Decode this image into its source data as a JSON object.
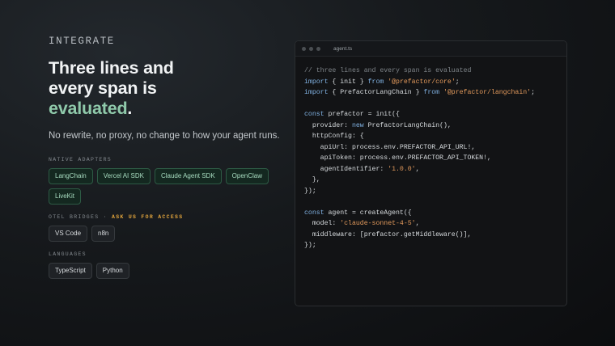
{
  "intro": {
    "eyebrow": "INTEGRATE",
    "headline_line1": "Three lines and",
    "headline_line2": "every span is",
    "headline_accent": "evaluated",
    "headline_period": ".",
    "subline": "No rewrite, no proxy, no change to how your agent runs."
  },
  "groups": {
    "native": {
      "label": "NATIVE ADAPTERS",
      "chips": [
        "LangChain",
        "Vercel AI SDK",
        "Claude Agent SDK",
        "OpenClaw",
        "LiveKit"
      ]
    },
    "otel": {
      "label": "OTEL BRIDGES · ",
      "access": "ASK US FOR ACCESS",
      "chips": [
        "VS Code",
        "n8n"
      ]
    },
    "languages": {
      "label": "LANGUAGES",
      "chips": [
        "TypeScript",
        "Python"
      ]
    }
  },
  "code_panel": {
    "filename": "agent.ts",
    "lines": [
      [
        [
          "com",
          "// three lines and every span is evaluated"
        ]
      ],
      [
        [
          "kw",
          "import"
        ],
        [
          "txt",
          " { init } "
        ],
        [
          "kw",
          "from"
        ],
        [
          "txt",
          " "
        ],
        [
          "str",
          "'@prefactor/core'"
        ],
        [
          "txt",
          ";"
        ]
      ],
      [
        [
          "kw",
          "import"
        ],
        [
          "txt",
          " { PrefactorLangChain } "
        ],
        [
          "kw",
          "from"
        ],
        [
          "txt",
          " "
        ],
        [
          "str",
          "'@prefactor/langchain'"
        ],
        [
          "txt",
          ";"
        ]
      ],
      [],
      [
        [
          "kw",
          "const"
        ],
        [
          "txt",
          " prefactor = init({"
        ]
      ],
      [
        [
          "txt",
          "  provider: "
        ],
        [
          "kw",
          "new"
        ],
        [
          "txt",
          " PrefactorLangChain(),"
        ]
      ],
      [
        [
          "txt",
          "  httpConfig: {"
        ]
      ],
      [
        [
          "txt",
          "    apiUrl: process.env.PREFACTOR_API_URL!,"
        ]
      ],
      [
        [
          "txt",
          "    apiToken: process.env.PREFACTOR_API_TOKEN!,"
        ]
      ],
      [
        [
          "txt",
          "    agentIdentifier: "
        ],
        [
          "str",
          "'1.0.0'"
        ],
        [
          "txt",
          ","
        ]
      ],
      [
        [
          "txt",
          "  },"
        ]
      ],
      [
        [
          "txt",
          "});"
        ]
      ],
      [],
      [
        [
          "kw",
          "const"
        ],
        [
          "txt",
          " agent = createAgent({"
        ]
      ],
      [
        [
          "txt",
          "  model: "
        ],
        [
          "str",
          "'claude-sonnet-4-5'"
        ],
        [
          "txt",
          ","
        ]
      ],
      [
        [
          "txt",
          "  middleware: [prefactor.getMiddleware()],"
        ]
      ],
      [
        [
          "txt",
          "});"
        ]
      ]
    ]
  }
}
